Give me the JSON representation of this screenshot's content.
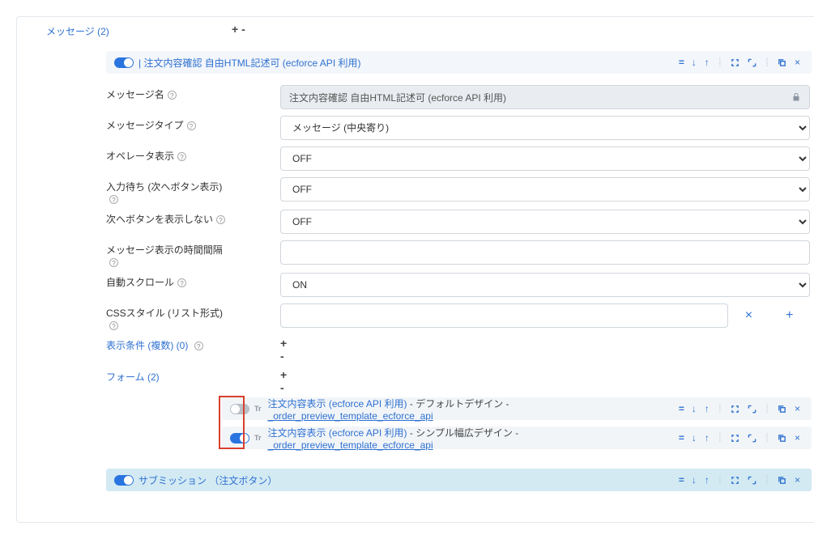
{
  "section": {
    "messages_label": "メッセージ (2)",
    "messages_signs": "+ -"
  },
  "message_header": {
    "title": "| 注文内容確認 自由HTML記述可 (ecforce API 利用)"
  },
  "fields": {
    "name": {
      "label": "メッセージ名",
      "value": "注文内容確認 自由HTML記述可 (ecforce API 利用)"
    },
    "type": {
      "label": "メッセージタイプ",
      "value": "メッセージ (中央寄り)"
    },
    "operator": {
      "label": "オペレータ表示",
      "value": "OFF"
    },
    "wait_next": {
      "label": "入力待ち (次へボタン表示)",
      "value": "OFF"
    },
    "hide_next": {
      "label": "次へボタンを表示しない",
      "value": "OFF"
    },
    "interval": {
      "label": "メッセージ表示の時間間隔",
      "value": ""
    },
    "autoscroll": {
      "label": "自動スクロール",
      "value": "ON"
    },
    "css": {
      "label": "CSSスタイル (リスト形式)",
      "value": ""
    },
    "conditions": {
      "label": "表示条件 (複数) (0)",
      "signs": "+ -"
    },
    "form": {
      "label": "フォーム (2)",
      "signs": "+ -"
    }
  },
  "forms": [
    {
      "toggle_on": false,
      "l1": "注文内容表示 (ecforce API 利用)",
      "l2": " - デフォルトデザイン - ",
      "l3": "_order_preview_template_ecforce_api"
    },
    {
      "toggle_on": true,
      "l1": "注文内容表示 (ecforce API 利用)",
      "l2": " - シンプル幅広デザイン - ",
      "l3": "_order_preview_template_ecforce_api"
    }
  ],
  "submission": {
    "title": "サブミッション （注文ボタン）"
  }
}
